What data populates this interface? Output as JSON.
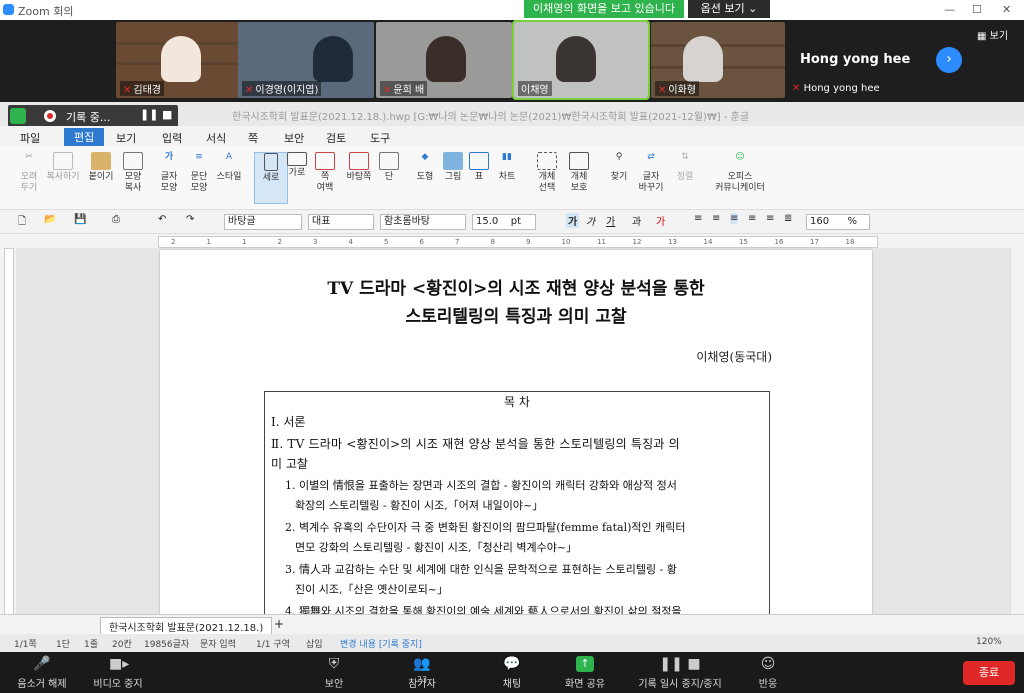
{
  "zoom": {
    "window_title": "Zoom 회의",
    "share_banner": "이채영의 화면을 보고 있습니다",
    "options_button": "옵션 보기",
    "view_button": "보기",
    "participants": [
      {
        "name": "김태경"
      },
      {
        "name": "이경영(이지엽)"
      },
      {
        "name": "윤희 배"
      },
      {
        "name": "이채영"
      },
      {
        "name": "이화형"
      }
    ],
    "featured_name": "Hong yong hee",
    "featured_sub": "Hong yong hee",
    "recording": {
      "label": "기록 중..."
    },
    "controls": [
      {
        "label": "음소거 해제",
        "icon": "mic-muted-icon"
      },
      {
        "label": "비디오 중지",
        "icon": "video-icon"
      },
      {
        "label": "보안",
        "icon": "shield-icon"
      },
      {
        "label": "참가자",
        "icon": "participants-icon",
        "count": "23"
      },
      {
        "label": "채팅",
        "icon": "chat-icon"
      },
      {
        "label": "화면 공유",
        "icon": "share-screen-icon"
      },
      {
        "label": "기록 일시 중지/중지",
        "icon": "record-icon"
      },
      {
        "label": "반응",
        "icon": "reaction-icon"
      }
    ],
    "end_button": "종료"
  },
  "hwp": {
    "title": "한국시조학회 발표문(2021.12.18.).hwp [G:₩나의 논문₩나의 논문(2021)₩한국시조학회 발표(2021-12월)₩] - 훈글",
    "menus": [
      "파일",
      "편집",
      "보기",
      "입력",
      "서식",
      "쪽",
      "보안",
      "검토",
      "도구"
    ],
    "ribbon": [
      {
        "l1": "오려",
        "l2": "두기"
      },
      {
        "l1": "복사하기",
        "l2": ""
      },
      {
        "l1": "붙이기",
        "l2": ""
      },
      {
        "l1": "모양",
        "l2": "복사"
      },
      {
        "l1": "글자",
        "l2": "모양"
      },
      {
        "l1": "문단",
        "l2": "모양"
      },
      {
        "l1": "스타일",
        "l2": ""
      },
      {
        "l1": "세로",
        "l2": ""
      },
      {
        "l1": "가로",
        "l2": ""
      },
      {
        "l1": "쪽",
        "l2": "여백"
      },
      {
        "l1": "바탕쪽",
        "l2": ""
      },
      {
        "l1": "단",
        "l2": ""
      },
      {
        "l1": "도형",
        "l2": ""
      },
      {
        "l1": "그림",
        "l2": ""
      },
      {
        "l1": "표",
        "l2": ""
      },
      {
        "l1": "차트",
        "l2": ""
      },
      {
        "l1": "개체",
        "l2": "선택"
      },
      {
        "l1": "개체",
        "l2": "보호"
      },
      {
        "l1": "찾기",
        "l2": ""
      },
      {
        "l1": "글자",
        "l2": "바꾸기"
      },
      {
        "l1": "정렬",
        "l2": ""
      },
      {
        "l1": "오피스",
        "l2": "커뮤니케이터"
      }
    ],
    "style_combo": "바탕글",
    "para_combo": "대표",
    "font_combo": "함초롬바탕",
    "size_combo": "15.0",
    "size_unit": "pt",
    "zoom_combo": "160",
    "zoom_unit": "%",
    "ruler_ticks": [
      "2",
      "1",
      "1",
      "2",
      "3",
      "4",
      "5",
      "6",
      "7",
      "8",
      "9",
      "10",
      "11",
      "12",
      "13",
      "14",
      "15",
      "16",
      "17",
      "18"
    ],
    "tab_name": "한국시조학회 발표문(2021.12.18.)",
    "status": [
      "1/1쪽",
      "1단",
      "1줄",
      "20칸",
      "19856글자",
      "문자 입력",
      "1/1 구역",
      "삽입",
      "변경 내용 [기록 중지]",
      "120%"
    ]
  },
  "document": {
    "title_line1": "TV 드라마 <황진이>의 시조 재현 양상 분석을 통한",
    "title_line2": "스토리텔링의 특징과 의미 고찰",
    "author": "이채영(동국대)",
    "toc_heading": "목 차",
    "toc_lines": [
      "Ⅰ. 서론",
      "Ⅱ. TV 드라마 <황진이>의 시조 재현 양상 분석을 통한 스토리텔링의 특징과 의",
      "미 고찰",
      "1. 이별의 情恨을 표출하는 장면과 시조의 결합 - 황진이의 캐릭터 강화와 애상적 정서",
      "확장의 스토리텔링 - 황진이 시조,「어져 내일이야~」",
      "2. 벽계수 유혹의 수단이자 극 중 변화된 황진이의 팜므파탈(femme fatal)적인 캐릭터",
      "면모 강화의 스토리텔링 - 황진이 시조,「청산리 벽계수야~」",
      "3. 情人과 교감하는 수단 및 세계에 대한 인식을 문학적으로 표현하는 스토리텔링 - 황",
      "진이 시조,「산은 옛산이로되~」",
      "4. 獨舞와 시조의 결합을 통해 황진이의 예술 세계와 藝人으로서의 황진이 삶의 절정을"
    ]
  }
}
